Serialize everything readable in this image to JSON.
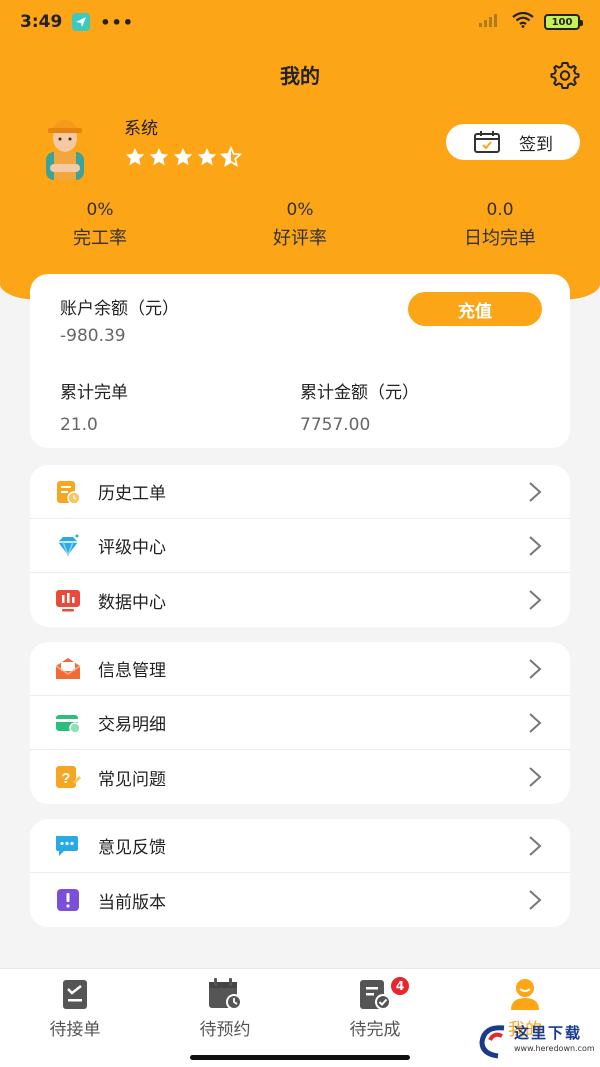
{
  "status_bar": {
    "time": "3:49",
    "dots": "•••",
    "battery": "100"
  },
  "header": {
    "title": "我的"
  },
  "profile": {
    "name": "系统",
    "rating": 4.5,
    "signin_label": "签到"
  },
  "stats": [
    {
      "value": "0%",
      "label": "完工率"
    },
    {
      "value": "0%",
      "label": "好评率"
    },
    {
      "value": "0.0",
      "label": "日均完单"
    }
  ],
  "account": {
    "balance_label": "账户余额（元）",
    "balance_value": "-980.39",
    "recharge_label": "充值",
    "total_orders_label": "累计完单",
    "total_orders_value": "21.0",
    "total_amount_label": "累计金额（元）",
    "total_amount_value": "7757.00"
  },
  "menu_groups": [
    {
      "items": [
        {
          "label": "历史工单",
          "icon": "history-orders-icon"
        },
        {
          "label": "评级中心",
          "icon": "diamond-icon"
        },
        {
          "label": "数据中心",
          "icon": "data-chart-icon"
        }
      ]
    },
    {
      "items": [
        {
          "label": "信息管理",
          "icon": "mail-icon"
        },
        {
          "label": "交易明细",
          "icon": "card-icon"
        },
        {
          "label": "常见问题",
          "icon": "question-icon"
        }
      ]
    },
    {
      "items": [
        {
          "label": "意见反馈",
          "icon": "feedback-icon"
        },
        {
          "label": "当前版本",
          "icon": "version-icon"
        }
      ]
    }
  ],
  "tabbar": {
    "items": [
      {
        "label": "待接单",
        "icon": "clipboard-check-icon"
      },
      {
        "label": "待预约",
        "icon": "calendar-clock-icon"
      },
      {
        "label": "待完成",
        "icon": "clipboard-done-icon",
        "badge": "4"
      },
      {
        "label": "我的",
        "icon": "person-icon"
      }
    ]
  },
  "watermark": {
    "text": "这里下载",
    "url": "www.heredown.com"
  },
  "colors": {
    "accent": "#fca516",
    "badge": "#e8262b"
  }
}
